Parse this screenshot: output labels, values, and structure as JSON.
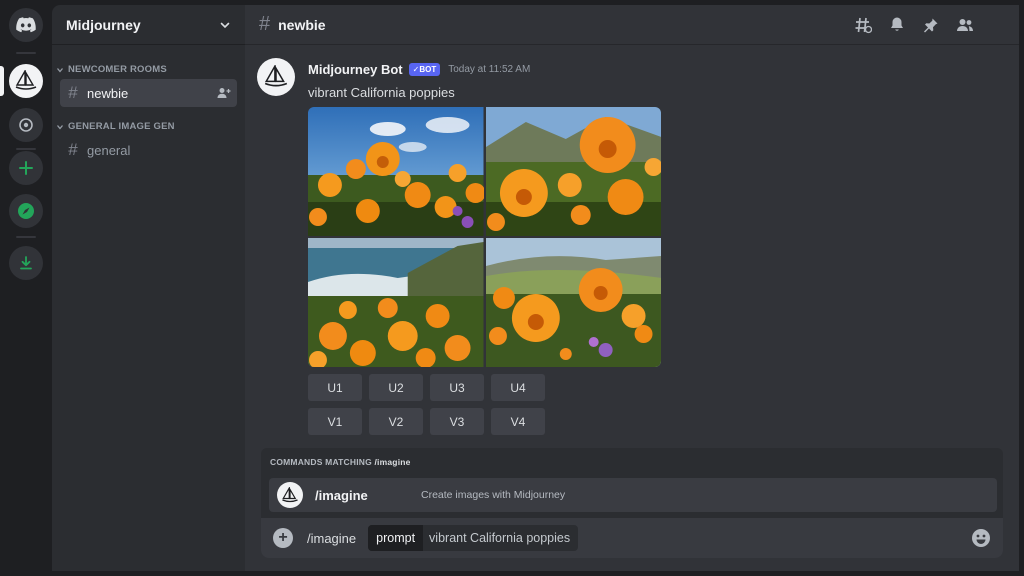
{
  "server": {
    "name": "Midjourney"
  },
  "sidebar": {
    "categories": [
      {
        "label": "NEWCOMER ROOMS",
        "channels": [
          {
            "label": "newbie",
            "active": true
          }
        ]
      },
      {
        "label": "GENERAL IMAGE GEN",
        "channels": [
          {
            "label": "general",
            "active": false
          }
        ]
      }
    ]
  },
  "channel": {
    "title": "newbie",
    "hash": "#"
  },
  "message": {
    "author": "Midjourney Bot",
    "badge": "✓BOT",
    "timestamp": "Today at 11:52 AM",
    "text": "vibrant California poppies"
  },
  "actions": {
    "upscale": [
      "U1",
      "U2",
      "U3",
      "U4"
    ],
    "variation": [
      "V1",
      "V2",
      "V3",
      "V4"
    ]
  },
  "commands": {
    "title_prefix": "COMMANDS MATCHING",
    "query": "/imagine",
    "item_name": "/imagine",
    "item_desc": "Create images with Midjourney"
  },
  "input": {
    "command": "/imagine",
    "option_name": "prompt",
    "option_value": "vibrant California poppies"
  },
  "colors": {
    "accent": "#5865f2",
    "poppy": "#f28c1c",
    "rail_green": "#23a55a"
  }
}
